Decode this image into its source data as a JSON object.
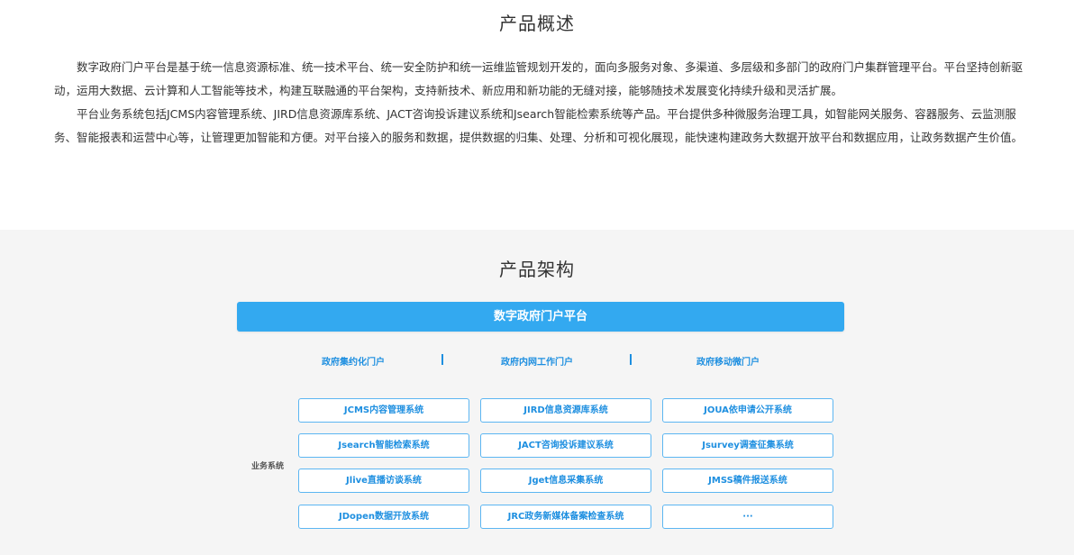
{
  "overview": {
    "title": "产品概述",
    "paragraphs": [
      "数字政府门户平台是基于统一信息资源标准、统一技术平台、统一安全防护和统一运维监管规划开发的，面向多服务对象、多渠道、多层级和多部门的政府门户集群管理平台。平台坚持创新驱动，运用大数据、云计算和人工智能等技术，构建互联融通的平台架构，支持新技术、新应用和新功能的无缝对接，能够随技术发展变化持续升级和灵活扩展。",
      "平台业务系统包括JCMS内容管理系统、JIRD信息资源库系统、JACT咨询投诉建议系统和Jsearch智能检索系统等产品。平台提供多种微服务治理工具，如智能网关服务、容器服务、云监测服务、智能报表和运营中心等，让管理更加智能和方便。对平台接入的服务和数据，提供数据的归集、处理、分析和可视化展现，能快速构建政务大数据开放平台和数据应用，让政务数据产生价值。"
    ]
  },
  "architecture": {
    "title": "产品架构",
    "platform": "数字政府门户平台",
    "portals": [
      "政府集约化门户",
      "政府内网工作门户",
      "政府移动微门户"
    ],
    "business_label": "业务系统",
    "systems": [
      [
        "JCMS内容管理系统",
        "JIRD信息资源库系统",
        "JOUA依申请公开系统"
      ],
      [
        "Jsearch智能检索系统",
        "JACT咨询投诉建议系统",
        "Jsurvey调查征集系统"
      ],
      [
        "Jlive直播访谈系统",
        "Jget信息采集系统",
        "JMSS稿件报送系统"
      ],
      [
        "JDopen数据开放系统",
        "JRC政务新媒体备案检查系统",
        "···"
      ]
    ]
  }
}
